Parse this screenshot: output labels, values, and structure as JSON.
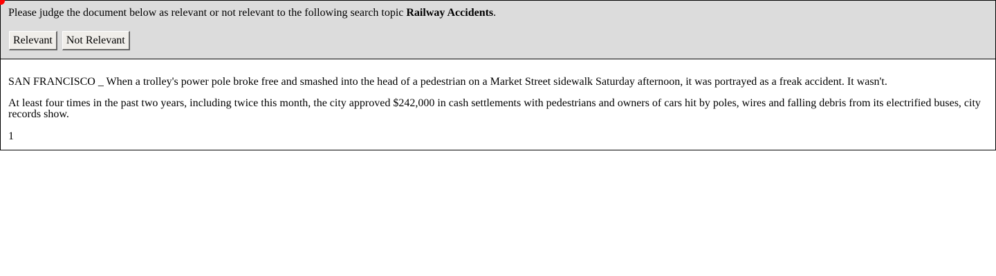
{
  "prompt": {
    "prefix": "Please judge the document below as relevant or not relevant to the following search topic ",
    "topic": "Railway Accidents",
    "suffix": "."
  },
  "buttons": {
    "relevant": "Relevant",
    "not_relevant": "Not Relevant"
  },
  "document": {
    "paragraphs": [
      "SAN FRANCISCO _ When a trolley's power pole broke free and smashed into the head of a pedestrian on a Market Street sidewalk Saturday afternoon, it was portrayed as a freak accident. It wasn't.",
      "At least four times in the past two years, including twice this month, the city approved $242,000 in cash settlements with pedestrians and owners of cars hit by poles, wires and falling debris from its electrified buses, city records show.",
      "1"
    ]
  },
  "colors": {
    "header_bg": "#dcdcdc",
    "cursor_marker": "#ff0000"
  }
}
